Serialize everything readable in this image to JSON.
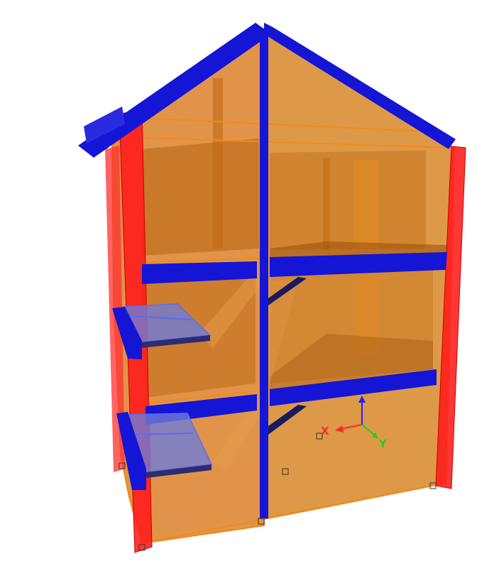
{
  "viewport": {
    "background": "#ffffff"
  },
  "colors": {
    "wall_fill": "#d9791b",
    "wall_dark": "#b8610e",
    "wall_edge": "#f08a1a",
    "column_red": "#ff1a1a",
    "beam_blue": "#1515d6",
    "slab_edge": "#5a6cf0"
  },
  "axes_triad": {
    "x_label": "X",
    "y_label": "Y",
    "x_color": "#ff2a2a",
    "y_color": "#22cc22",
    "z_color": "#2222ff"
  }
}
